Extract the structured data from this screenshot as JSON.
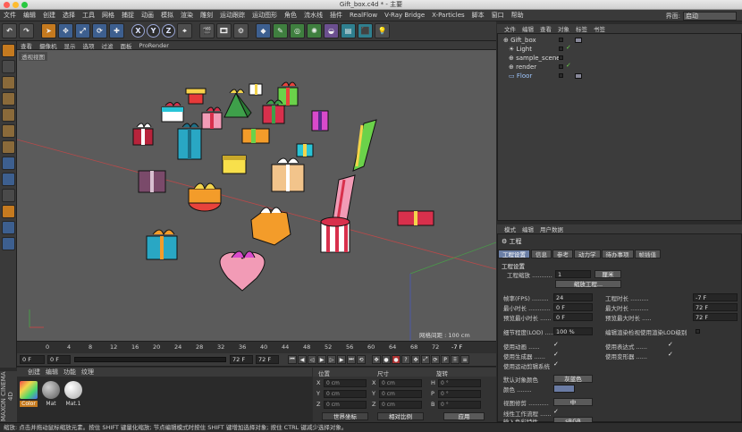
{
  "window": {
    "title": "Gift_box.c4d * - 主要"
  },
  "menu": [
    "文件",
    "编辑",
    "创建",
    "选择",
    "工具",
    "网格",
    "捕捉",
    "动画",
    "模拟",
    "渲染",
    "雕刻",
    "运动跟踪",
    "运动图形",
    "角色",
    "流水线",
    "插件",
    "RealFlow",
    "V-Ray Bridge",
    "X-Particles",
    "脚本",
    "窗口",
    "帮助"
  ],
  "layout": {
    "label": "界面:",
    "value": "启动"
  },
  "viewport_menu": [
    "查看",
    "摄像机",
    "显示",
    "选项",
    "过滤",
    "面板",
    "ProRender"
  ],
  "viewport": {
    "label": "透视视图",
    "grid": "网格间距 : 100 cm"
  },
  "timeline": {
    "ticks": [
      "0",
      "4",
      "8",
      "12",
      "16",
      "20",
      "24",
      "28",
      "32",
      "36",
      "40",
      "44",
      "48",
      "52",
      "56",
      "60",
      "64",
      "68",
      "72"
    ],
    "end": "-7 F"
  },
  "playback": {
    "start": "0 F",
    "current": "0 F",
    "end": "72 F",
    "end2": "72 F"
  },
  "material_menu": [
    "创建",
    "编辑",
    "功能",
    "纹理"
  ],
  "materials": [
    {
      "name": "Color",
      "color": "#d94a8c"
    },
    {
      "name": "Mat",
      "color": "#9a9a9a"
    },
    {
      "name": "Mat.1",
      "color": "#f2f2f2"
    }
  ],
  "brand": "MAXON CINEMA 4D",
  "coords": {
    "headers": [
      "位置",
      "尺寸",
      "旋转"
    ],
    "rows": [
      {
        "a": "X",
        "v1": "0 cm",
        "b": "X",
        "v2": "0 cm",
        "c": "H",
        "v3": "0 °"
      },
      {
        "a": "Y",
        "v1": "0 cm",
        "b": "Y",
        "v2": "0 cm",
        "c": "P",
        "v3": "0 °"
      },
      {
        "a": "Z",
        "v1": "0 cm",
        "b": "Z",
        "v2": "0 cm",
        "c": "B",
        "v3": "0 °"
      }
    ],
    "mode1": "世界坐标",
    "mode2": "相对比例",
    "apply": "应用"
  },
  "objects_menu": [
    "文件",
    "编辑",
    "查看",
    "对象",
    "标签",
    "书签"
  ],
  "objects": [
    {
      "name": "Gift_box"
    },
    {
      "name": "Light"
    },
    {
      "name": "sample_scenes"
    },
    {
      "name": "render"
    },
    {
      "name": "Floor"
    }
  ],
  "attr_menu": [
    "模式",
    "编辑",
    "用户数据"
  ],
  "attr": {
    "title": "工程",
    "tabs": [
      "工程设置",
      "信息",
      "参考",
      "动力学",
      "待办事项",
      "帧插值"
    ],
    "section": "工程设置",
    "scale_label": "工程缩放 ...........",
    "scale_value": "1",
    "scale_unit": "厘米",
    "scale_button": "缩放工程...",
    "fields_left": [
      {
        "label": "帧率(FPS) .........",
        "value": "24"
      },
      {
        "label": "最小时长 ............",
        "value": "0 F"
      },
      {
        "label": "预览最小时长 ......",
        "value": "0 F"
      }
    ],
    "fields_right": [
      {
        "label": "工程时长 ..........",
        "value": "-7 F"
      },
      {
        "label": "最大时长 ..........",
        "value": "72 F"
      },
      {
        "label": "预览最大时长 .....",
        "value": "72 F"
      }
    ],
    "lod_label": "细节程度(LOD) .....",
    "lod_value": "100 %",
    "lod_check": "编辑渲染检视使用渲染LOD级别",
    "checks_left": [
      "使用动画 ......",
      "使用生成器 ......",
      "使用运动剪辑系统"
    ],
    "checks_right": [
      "使用表达式 ......",
      "使用变形器 ......"
    ],
    "default_color_label": "默认对象颜色",
    "default_color_value": "灰蓝色",
    "color_label": "颜色 ........",
    "view_clip_label": "视图修剪 ...........",
    "view_clip_value": "中",
    "linear_label": "线性工作流程 ......",
    "input_profile_label": "输入色彩特性 ......",
    "input_profile_value": "sRGB"
  },
  "status": "缩放: 点击并拖动鼠标缩放元素。按住 SHIFT 键量化缩放; 节点编辑模式时按住 SHIFT 键增加选择对象; 按住 CTRL 键减少选择对象。"
}
